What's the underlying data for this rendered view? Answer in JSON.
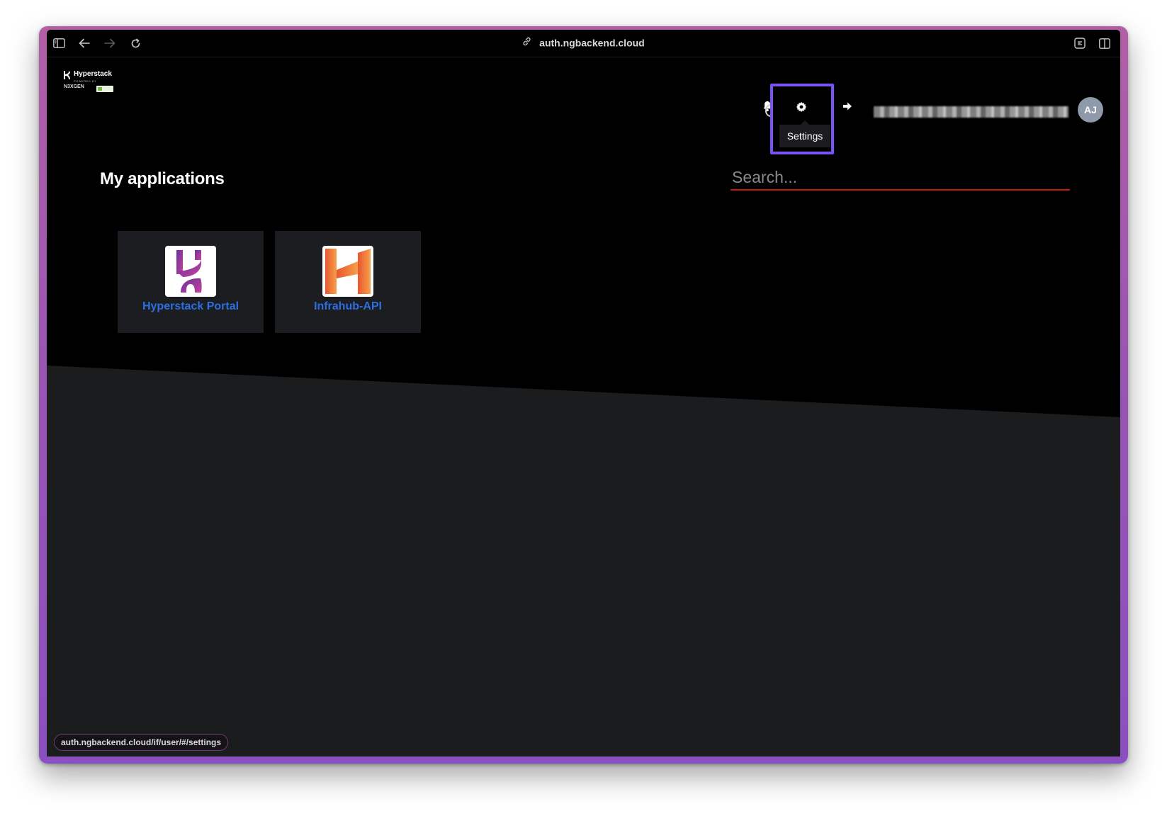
{
  "browser": {
    "url": "auth.ngbackend.cloud",
    "status_url": "auth.ngbackend.cloud/if/user/#/settings"
  },
  "brand": {
    "name": "Hyperstack",
    "sub": "POWERED BY",
    "parent": "N3XGEN"
  },
  "header": {
    "settings_tooltip": "Settings",
    "avatar_initials": "AJ"
  },
  "main": {
    "title": "My applications",
    "search_placeholder": "Search...",
    "apps": [
      {
        "label": "Hyperstack Portal",
        "icon": "hyperstack-logo"
      },
      {
        "label": "Infrahub-API",
        "icon": "infrahub-logo"
      }
    ]
  },
  "colors": {
    "accent_link": "#2b6fe0",
    "highlight": "#7b52f5",
    "search_underline": "#c9190b"
  }
}
